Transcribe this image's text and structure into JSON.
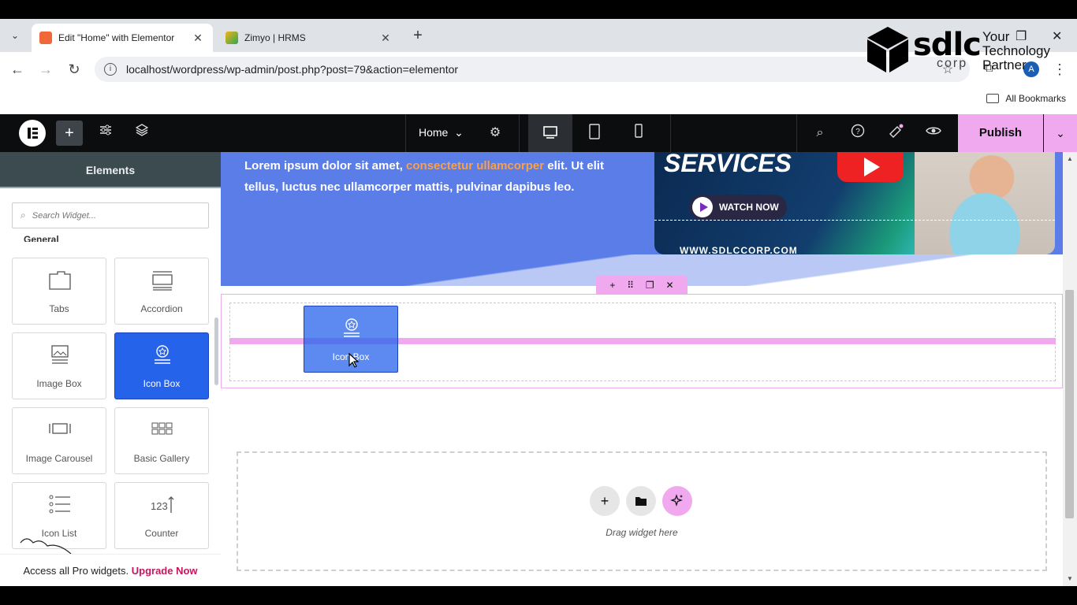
{
  "browser": {
    "tabs": [
      {
        "title": "Edit \"Home\" with Elementor",
        "active": true
      },
      {
        "title": "Zimyo | HRMS",
        "active": false
      }
    ],
    "url": "localhost/wordpress/wp-admin/post.php?post=79&action=elementor",
    "bookmarks_label": "All Bookmarks"
  },
  "logo": {
    "word": "sdlc",
    "sub": "corp",
    "tagline": "Your Technology Partner"
  },
  "editor": {
    "page_name": "Home",
    "publish_label": "Publish",
    "panel_title": "Elements",
    "search_placeholder": "Search Widget...",
    "category_label": "General",
    "widgets": [
      {
        "label": "Tabs",
        "icon": "tabs-icon"
      },
      {
        "label": "Accordion",
        "icon": "accordion-icon"
      },
      {
        "label": "Image Box",
        "icon": "image-box-icon"
      },
      {
        "label": "Icon Box",
        "icon": "icon-box-icon",
        "selected": true
      },
      {
        "label": "Image Carousel",
        "icon": "image-carousel-icon"
      },
      {
        "label": "Basic Gallery",
        "icon": "gallery-icon"
      },
      {
        "label": "Icon List",
        "icon": "icon-list-icon"
      },
      {
        "label": "Counter",
        "icon": "counter-icon"
      }
    ],
    "upgrade_text": "Access all Pro widgets.",
    "upgrade_link": "Upgrade Now"
  },
  "canvas": {
    "hero_text_a": "Lorem ipsum dolor sit amet,",
    "hero_text_highlight": "consectetur ullamcorper",
    "hero_text_b": "elit. Ut elit tellus, luctus nec ullamcorper mattis, pulvinar dapibus leo.",
    "promo_title": "SERVICES",
    "promo_button": "WATCH NOW",
    "promo_url": "WWW.SDLCCORP.COM",
    "drag_label": "Icon Box",
    "drop_hint": "Drag widget here"
  },
  "colors": {
    "accent": "#f0a9ee",
    "selected": "#2563eb",
    "hero": "#5a7de8",
    "highlight": "#f7a14a"
  }
}
